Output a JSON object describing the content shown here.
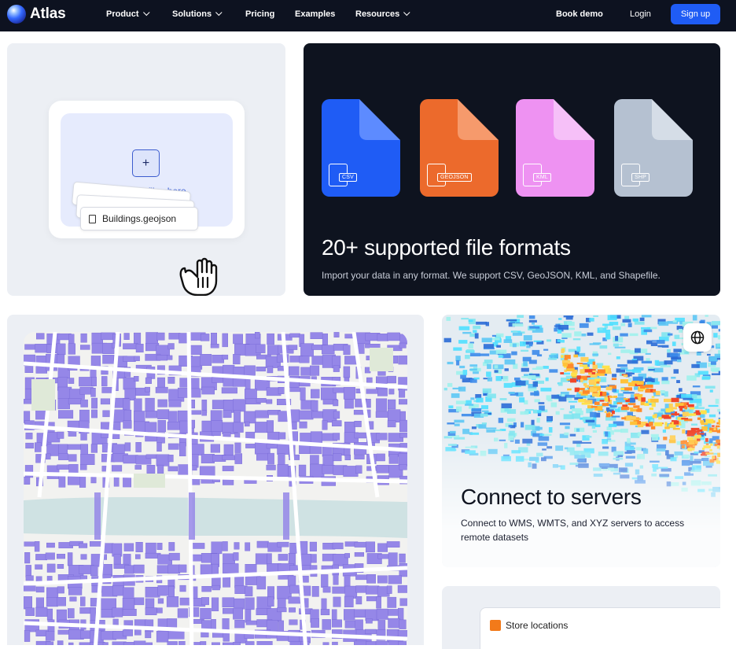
{
  "brand": {
    "name": "Atlas"
  },
  "nav": {
    "items": [
      {
        "label": "Product",
        "has_menu": true
      },
      {
        "label": "Solutions",
        "has_menu": true
      },
      {
        "label": "Pricing",
        "has_menu": false
      },
      {
        "label": "Examples",
        "has_menu": false
      },
      {
        "label": "Resources",
        "has_menu": true
      }
    ],
    "book_demo": "Book demo",
    "login": "Login",
    "signup": "Sign up"
  },
  "upload_card": {
    "drop_text": "Drop your files here",
    "file_name": "Buildings.geojson"
  },
  "formats_card": {
    "title": "20+ supported file formats",
    "description": "Import your data in any format. We support CSV, GeoJSON, KML, and Shapefile.",
    "files": [
      {
        "label": "CSV",
        "color": "#1f5cf5",
        "fold": "#5d8bff"
      },
      {
        "label": "GEOJSON",
        "color": "#ec6a2c",
        "fold": "#f69a6c"
      },
      {
        "label": "KML",
        "color": "#ee92f2",
        "fold": "#f6c0f8"
      },
      {
        "label": "SHP",
        "color": "#b5c1d1",
        "fold": "#d5dde7"
      }
    ]
  },
  "servers_card": {
    "title": "Connect to servers",
    "description": "Connect to WMS, WMTS, and XYZ servers to access remote datasets",
    "icon": "globe-icon"
  },
  "store_card": {
    "legend_label": "Store locations",
    "legend_color": "#f27a1a"
  },
  "colors": {
    "nav_bg": "#0d1220",
    "accent": "#1f5cf5",
    "building_fill": "#9587e8",
    "river": "#cfe2e3"
  }
}
